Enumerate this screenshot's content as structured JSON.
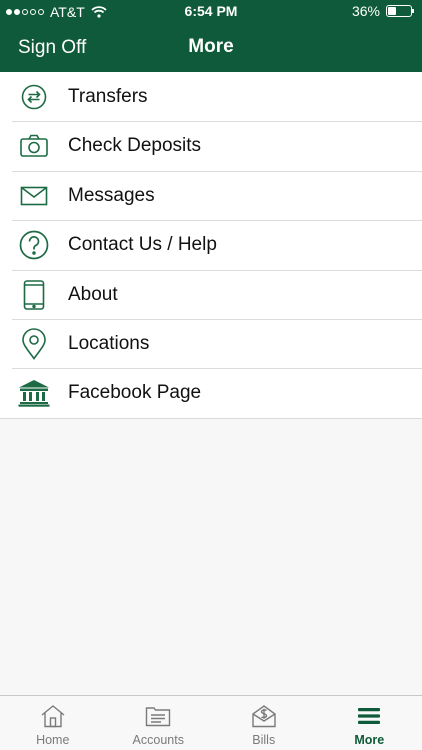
{
  "status_bar": {
    "carrier": "AT&T",
    "time": "6:54 PM",
    "battery_text": "36%",
    "battery_level": 0.36
  },
  "header": {
    "sign_off_label": "Sign Off",
    "title": "More"
  },
  "menu": {
    "items": [
      {
        "label": "Transfers",
        "icon": "transfer-arrows-icon"
      },
      {
        "label": "Check Deposits",
        "icon": "camera-icon"
      },
      {
        "label": "Messages",
        "icon": "envelope-icon"
      },
      {
        "label": "Contact Us / Help",
        "icon": "question-circle-icon"
      },
      {
        "label": "About",
        "icon": "phone-device-icon"
      },
      {
        "label": "Locations",
        "icon": "map-pin-icon"
      },
      {
        "label": "Facebook Page",
        "icon": "bank-building-icon"
      }
    ]
  },
  "tabbar": {
    "tabs": [
      {
        "label": "Home",
        "icon": "home-icon"
      },
      {
        "label": "Accounts",
        "icon": "accounts-icon"
      },
      {
        "label": "Bills",
        "icon": "bills-icon"
      },
      {
        "label": "More",
        "icon": "menu-bars-icon"
      }
    ],
    "active": "More"
  },
  "colors": {
    "brand_green": "#0f5a3a",
    "icon_green": "#1d6b45",
    "inactive_gray": "#7a7a7a"
  }
}
